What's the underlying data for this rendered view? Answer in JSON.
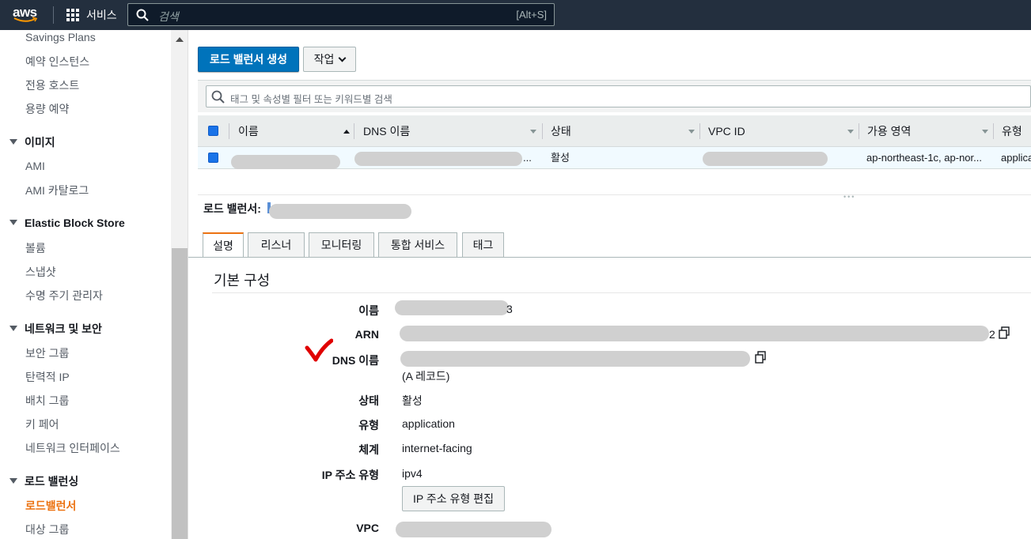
{
  "colors": {
    "nav_bg": "#232f3e",
    "accent": "#ec7211",
    "primary": "#0073bb",
    "checkmark": "#e00000"
  },
  "topnav": {
    "logo": "aws",
    "services_label": "서비스",
    "search_placeholder": "검색",
    "search_shortcut": "[Alt+S]"
  },
  "sidebar": {
    "items_top": [
      "Savings Plans",
      "예약 인스턴스",
      "전용 호스트",
      "용량 예약"
    ],
    "groups": [
      {
        "title": "이미지",
        "items": [
          "AMI",
          "AMI 카탈로그"
        ]
      },
      {
        "title": "Elastic Block Store",
        "items": [
          "볼륨",
          "스냅샷",
          "수명 주기 관리자"
        ]
      },
      {
        "title": "네트워크 및 보안",
        "items": [
          "보안 그룹",
          "탄력적 IP",
          "배치 그룹",
          "키 페어",
          "네트워크 인터페이스"
        ]
      },
      {
        "title": "로드 밸런싱",
        "items": [
          "로드밸런서",
          "대상 그룹"
        ]
      }
    ],
    "active_item": "로드밸런서"
  },
  "toolbar": {
    "create_label": "로드 밸런서 생성",
    "actions_label": "작업"
  },
  "filter": {
    "placeholder": "태그 및 속성별 필터 또는 키워드별 검색"
  },
  "table": {
    "columns": [
      "이름",
      "DNS 이름",
      "상태",
      "VPC ID",
      "가용 영역",
      "유형"
    ],
    "row": {
      "dns_suffix": "...",
      "state": "활성",
      "az": "ap-northeast-1c, ap-nor...",
      "type": "applica"
    }
  },
  "detail": {
    "lb_label": "로드 밸런서:",
    "tabs": [
      "설명",
      "리스너",
      "모니터링",
      "통합 서비스",
      "태그"
    ],
    "active_tab": "설명",
    "section_title": "기본 구성",
    "fields": {
      "name_label": "이름",
      "name_suffix": "3",
      "arn_label": "ARN",
      "arn_suffix": "2",
      "dns_label": "DNS 이름",
      "dns_note": "(A 레코드)",
      "state_label": "상태",
      "state_value": "활성",
      "type_label": "유형",
      "type_value": "application",
      "scheme_label": "체계",
      "scheme_value": "internet-facing",
      "ip_type_label": "IP 주소 유형",
      "ip_type_value": "ipv4",
      "edit_ip_button": "IP 주소 유형 편집",
      "vpc_label": "VPC"
    }
  }
}
